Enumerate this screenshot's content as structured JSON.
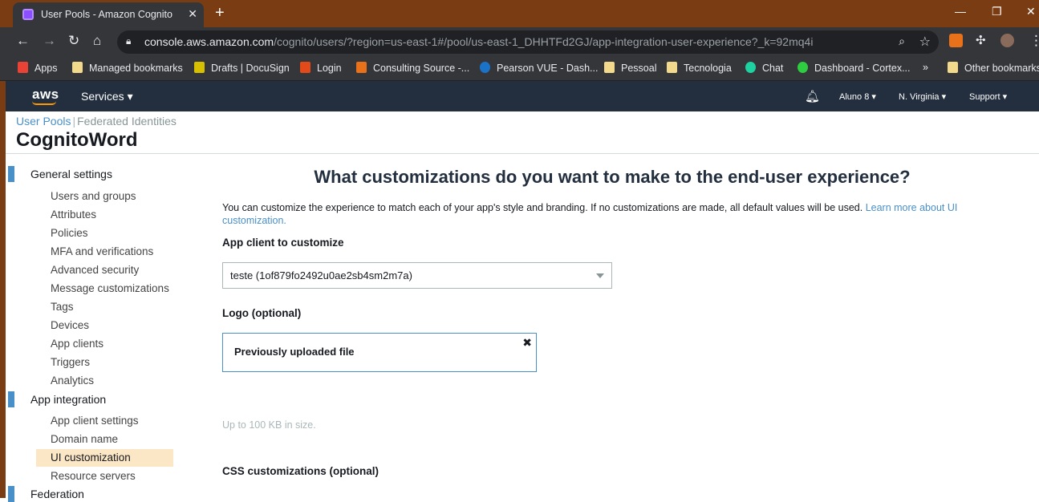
{
  "browser": {
    "tab_title": "User Pools - Amazon Cognito",
    "url_host": "console.aws.amazon.com",
    "url_path": "/cognito/users/?region=us-east-1#/pool/us-east-1_DHHTFd2GJ/app-integration-user-experience?_k=92mq4i",
    "bookmarks": [
      {
        "label": "Apps",
        "color": "#ea4335"
      },
      {
        "label": "Managed bookmarks",
        "color": "#f2d98b"
      },
      {
        "label": "Drafts | DocuSign",
        "color": "#d6c000"
      },
      {
        "label": "Login",
        "color": "#e24a1a"
      },
      {
        "label": "Consulting Source -...",
        "color": "#e8711a"
      },
      {
        "label": "Pearson VUE - Dash...",
        "color": "#1a73c8"
      },
      {
        "label": "Pessoal",
        "color": "#f2d98b"
      },
      {
        "label": "Tecnologia",
        "color": "#f2d98b"
      },
      {
        "label": "Chat",
        "color": "#1dd1a1"
      },
      {
        "label": "Dashboard - Cortex...",
        "color": "#2ecc40"
      }
    ],
    "more_bookmarks": "»",
    "other_bookmarks": "Other bookmarks"
  },
  "aws_header": {
    "logo": "aws",
    "services": "Services",
    "user": "Aluno 8",
    "region": "N. Virginia",
    "support": "Support"
  },
  "breadcrumb": {
    "user_pools": "User Pools",
    "separator": "|",
    "federated": "Federated Identities"
  },
  "pool_name": "CognitoWord",
  "sidebar": {
    "groups": [
      {
        "label": "General settings",
        "items": [
          "Users and groups",
          "Attributes",
          "Policies",
          "MFA and verifications",
          "Advanced security",
          "Message customizations",
          "Tags",
          "Devices",
          "App clients",
          "Triggers",
          "Analytics"
        ]
      },
      {
        "label": "App integration",
        "items": [
          "App client settings",
          "Domain name",
          "UI customization",
          "Resource servers"
        ]
      },
      {
        "label": "Federation",
        "items": []
      }
    ],
    "active_item": "UI customization"
  },
  "main": {
    "title": "What customizations do you want to make to the end-user experience?",
    "intro": "You can customize the experience to match each of your app's style and branding. If no customizations are made, all default values will be used.",
    "learn_more": "Learn more about UI customization.",
    "app_client_label": "App client to customize",
    "app_client_value": "teste (1of879fo2492u0ae2sb4sm2m7a)",
    "logo_label": "Logo (optional)",
    "uploaded_text": "Previously uploaded file",
    "remove_symbol": "✖",
    "size_hint": "Up to 100 KB in size.",
    "css_label": "CSS customizations (optional)"
  },
  "colors": {
    "aws_nav": "#232f3e",
    "link": "#4a90c8",
    "active_nav": "#fbe6c5",
    "browser_frame": "#7a3c13"
  }
}
